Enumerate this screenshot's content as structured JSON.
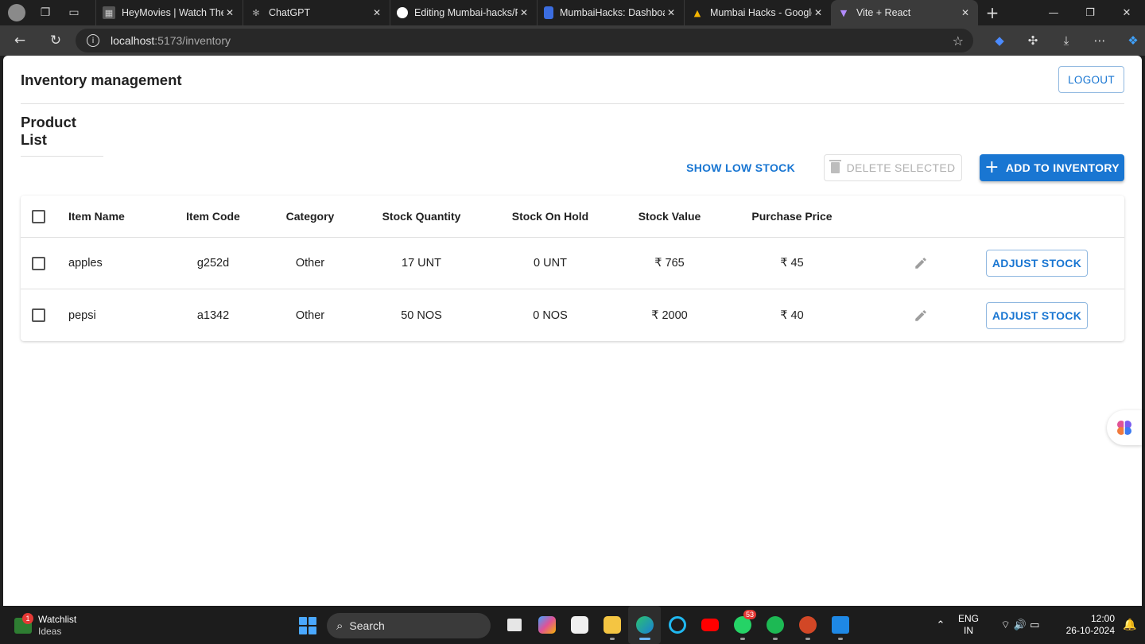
{
  "browser": {
    "tabs": [
      {
        "title": "HeyMovies | Watch The H",
        "favicon": "heymovies-icon"
      },
      {
        "title": "ChatGPT",
        "favicon": "chatgpt-icon"
      },
      {
        "title": "Editing Mumbai-hacks/RE",
        "favicon": "github-icon"
      },
      {
        "title": "MumbaiHacks: Dashboard",
        "favicon": "doc-icon"
      },
      {
        "title": "Mumbai Hacks - Google D",
        "favicon": "drive-icon"
      },
      {
        "title": "Vite + React",
        "favicon": "vite-icon"
      }
    ],
    "url_host": "localhost",
    "url_path": ":5173/inventory"
  },
  "app": {
    "title": "Inventory management",
    "logout_label": "LOGOUT",
    "section_title": "Product List",
    "actions": {
      "low_stock": "SHOW LOW STOCK",
      "delete_selected": "DELETE SELECTED",
      "add": "ADD TO INVENTORY"
    },
    "table": {
      "columns": [
        "Item Name",
        "Item Code",
        "Category",
        "Stock Quantity",
        "Stock On Hold",
        "Stock Value",
        "Purchase Price"
      ],
      "rows": [
        {
          "name": "apples",
          "code": "g252d",
          "category": "Other",
          "qty": "17 UNT",
          "hold": "0 UNT",
          "value": "₹ 765",
          "price": "₹ 45",
          "action": "ADJUST STOCK"
        },
        {
          "name": "pepsi",
          "code": "a1342",
          "category": "Other",
          "qty": "50 NOS",
          "hold": "0 NOS",
          "value": "₹ 2000",
          "price": "₹ 40",
          "action": "ADJUST STOCK"
        }
      ]
    },
    "accent_color": "#1976d2"
  },
  "taskbar": {
    "watchlist_title": "Watchlist",
    "watchlist_sub": "Ideas",
    "watchlist_badge": "1",
    "search_label": "Search",
    "whatsapp_badge": "53",
    "lang_top": "ENG",
    "lang_bottom": "IN",
    "time": "12:00",
    "date": "26-10-2024"
  }
}
